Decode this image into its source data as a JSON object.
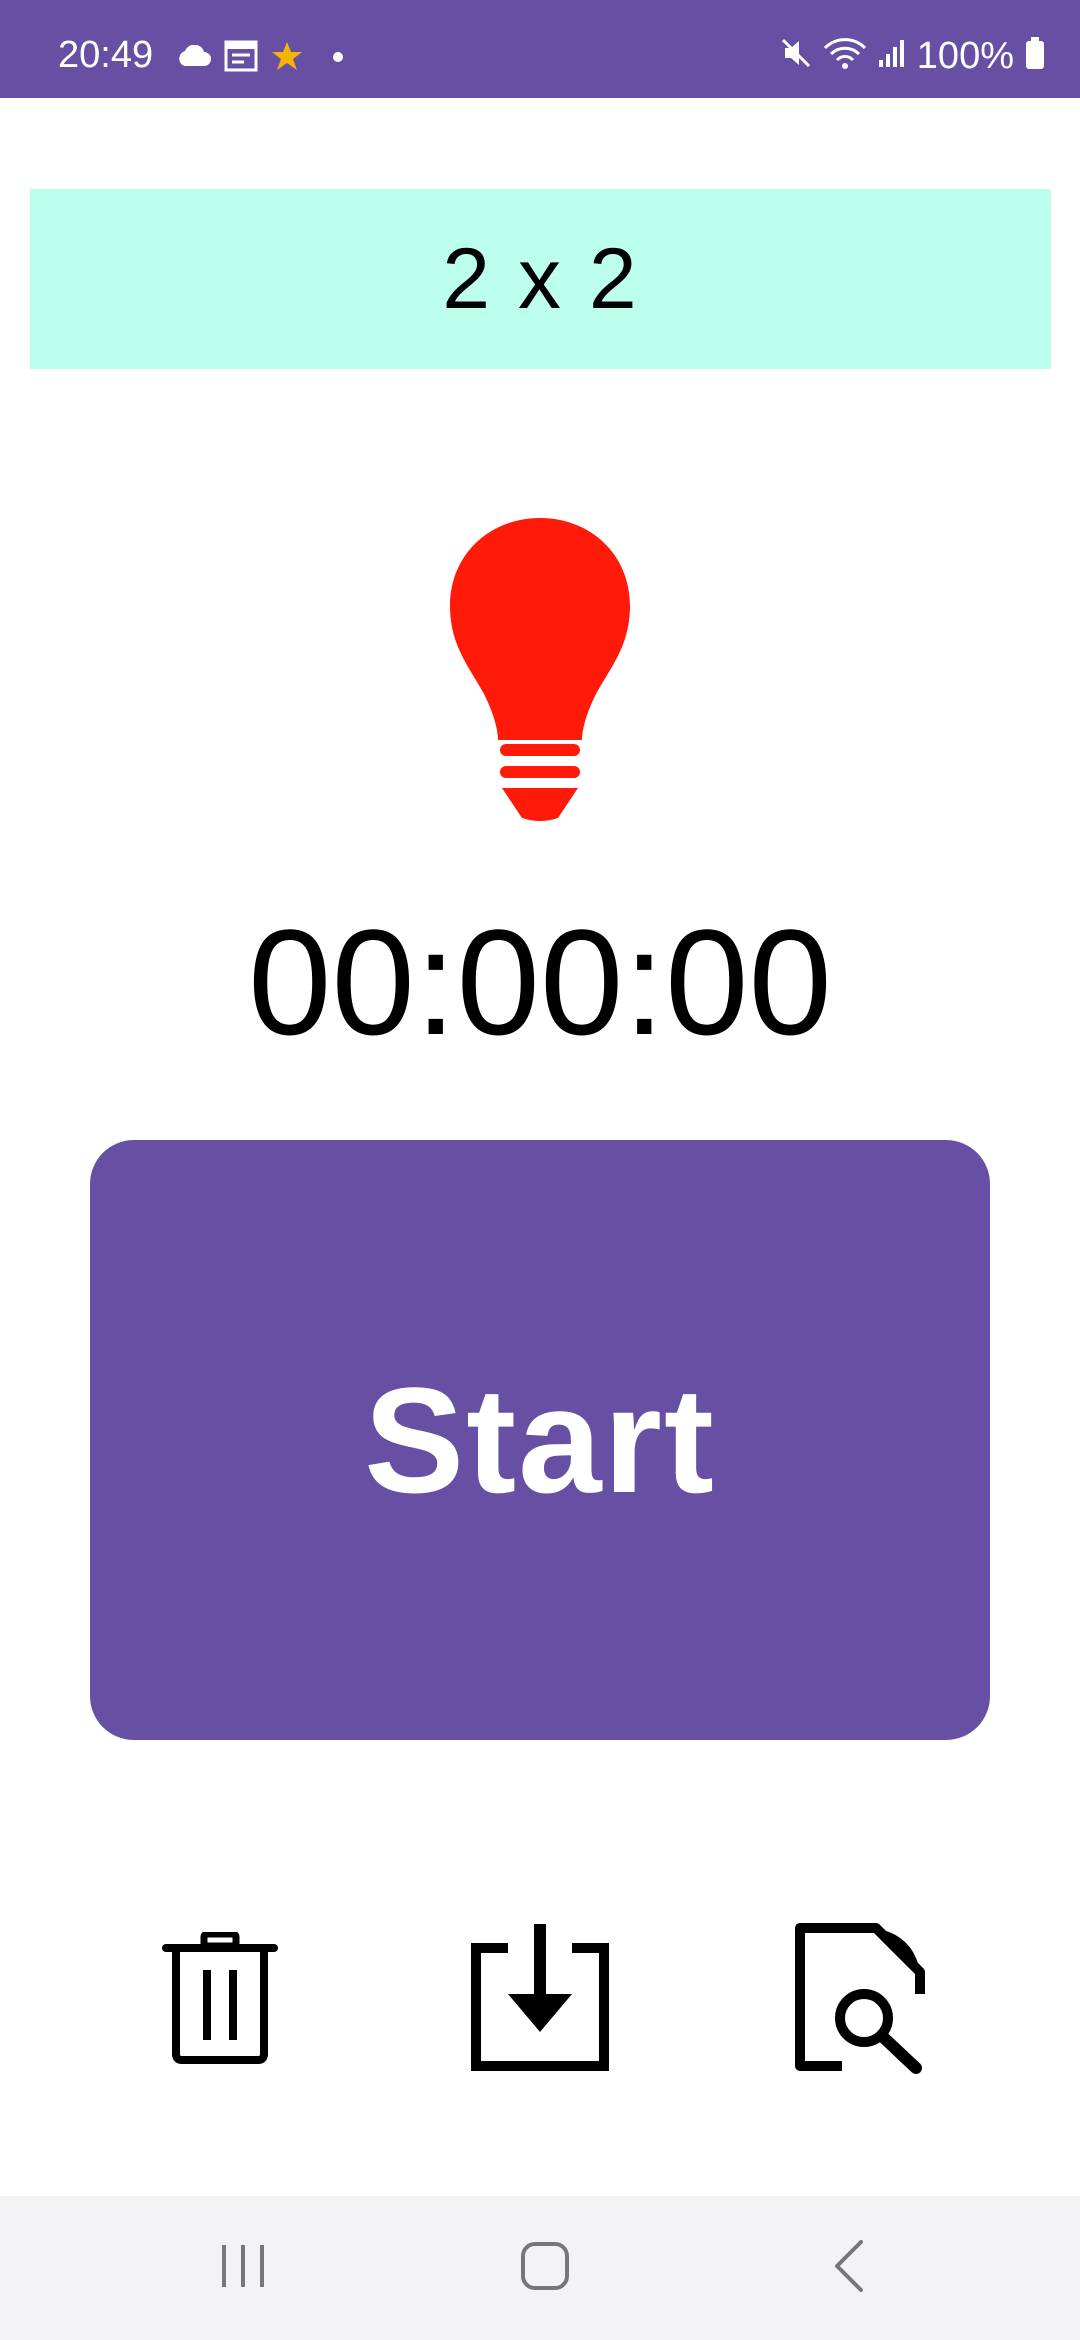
{
  "status_bar": {
    "time": "20:49",
    "battery": "100%",
    "background": "#6750A4",
    "left_icons": [
      "cloud-icon",
      "calendar-icon",
      "star-icon",
      "dot-icon"
    ],
    "right_icons": [
      "mute-icon",
      "wifi-icon",
      "signal-icon",
      "battery-icon"
    ]
  },
  "grid": {
    "label": "2 x 2",
    "background": "#BBFFEC"
  },
  "indicator": {
    "icon": "lightbulb-icon",
    "color": "#FF1A0A"
  },
  "timer": {
    "value": "00:00:00"
  },
  "start_button": {
    "label": "Start",
    "color": "#6750A4"
  },
  "actions": [
    {
      "icon": "trash-icon"
    },
    {
      "icon": "save-download-icon"
    },
    {
      "icon": "file-search-icon"
    }
  ],
  "nav_bar": {
    "buttons": [
      "recents-icon",
      "home-icon",
      "back-icon"
    ]
  }
}
